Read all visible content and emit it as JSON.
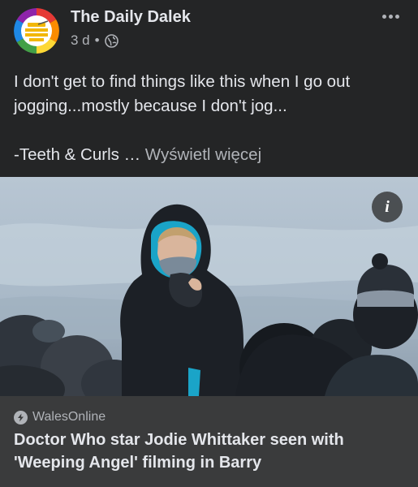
{
  "post": {
    "page_name": "The Daily Dalek",
    "time": "3 d",
    "separator": "•",
    "text_line1": "I don't get to find things like this when I go out jogging...mostly because I don't jog...",
    "text_line2": "-Teeth & Curls … ",
    "see_more": "Wyświetl więcej"
  },
  "link": {
    "source": "WalesOnline",
    "title": "Doctor Who star Jodie Whittaker seen with 'Weeping Angel' filming in Barry"
  },
  "icons": {
    "avatar": "rainbow-dalek-logo",
    "privacy": "globe-icon",
    "more": "more-options-icon",
    "info": "info-icon",
    "source": "bolt-icon"
  },
  "colors": {
    "background": "#242526",
    "card": "#3a3b3c",
    "text_primary": "#e4e6eb",
    "text_secondary": "#b0b3b8"
  }
}
